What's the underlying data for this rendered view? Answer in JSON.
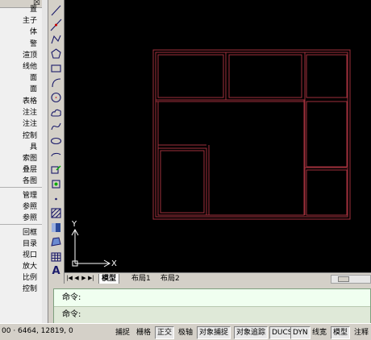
{
  "palette": {
    "close_glyph": "☒",
    "items": [
      "置",
      "主子",
      "体",
      "警",
      "渲顶",
      "线他",
      "面",
      "面",
      "表格",
      "注注",
      "注注",
      "控制",
      "具",
      "索图",
      "叠层",
      "各图",
      "管理",
      "参照",
      "参照",
      "回框",
      "目录",
      "视口",
      "放大",
      "比例",
      "控制"
    ]
  },
  "draw_tools": [
    "line-icon",
    "construction-line-icon",
    "polyline-icon",
    "polygon-icon",
    "rectangle-icon",
    "arc-icon",
    "circle-icon",
    "revision-cloud-icon",
    "spline-icon",
    "ellipse-icon",
    "ellipse-arc-icon",
    "insert-block-icon",
    "make-block-icon",
    "point-icon",
    "hatch-icon",
    "gradient-icon",
    "region-icon",
    "table-icon",
    "multiline-text-icon"
  ],
  "draw_tools_extra_label": "A",
  "canvas": {
    "background": "#000000",
    "linework_color": "#a0303c",
    "ucs_x": "X",
    "ucs_y": "Y"
  },
  "tabs": {
    "nav": [
      "|◀",
      "◀",
      "▶",
      "▶|"
    ],
    "items": [
      "模型",
      "布局1",
      "布局2"
    ],
    "active": "模型"
  },
  "command": {
    "line1": "命令:",
    "line2": "命令:"
  },
  "status": {
    "coords": "00 ·  6464, 12819, 0",
    "buttons": [
      {
        "label": "捕捉",
        "on": false
      },
      {
        "label": "栅格",
        "on": false
      },
      {
        "label": "正交",
        "on": true
      },
      {
        "label": "极轴",
        "on": false
      },
      {
        "label": "对象捕捉",
        "on": true
      },
      {
        "label": "对象追踪",
        "on": true
      },
      {
        "label": "DUCS",
        "on": true
      },
      {
        "label": "DYN",
        "on": true
      },
      {
        "label": "线宽",
        "on": false
      },
      {
        "label": "模型",
        "on": true
      },
      {
        "label": "注释",
        "on": false
      }
    ]
  }
}
